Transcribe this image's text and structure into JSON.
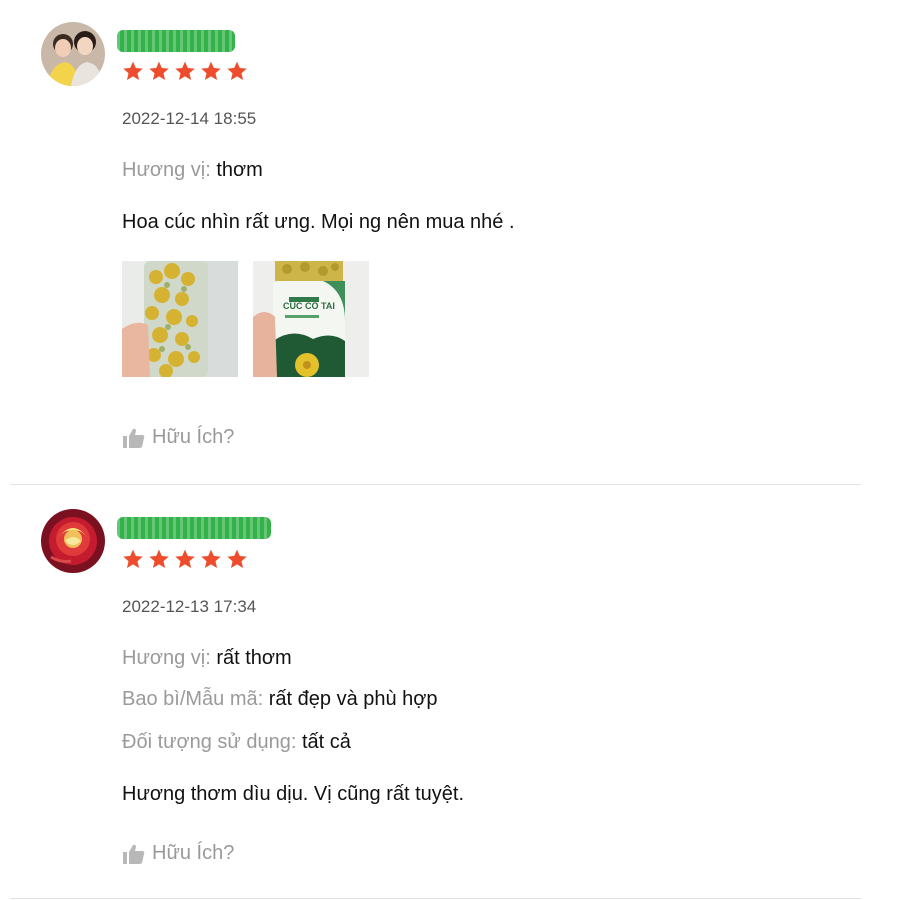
{
  "reviews": [
    {
      "username_hidden": true,
      "rating": 5,
      "date": "2022-12-14 18:55",
      "attributes": [
        {
          "key": "Hương vị:",
          "value": "thơm"
        }
      ],
      "comment": "Hoa cúc nhìn rất ưng. Mọi ng nên mua nhé .",
      "photos": [
        {
          "alt": "Jar of dried chrysanthemum flowers"
        },
        {
          "alt": "Cúc Cổ Tai product jar",
          "label": "CÚC CỔ TAI"
        }
      ],
      "helpful_label": "Hữu Ích?"
    },
    {
      "username_hidden": true,
      "rating": 5,
      "date": "2022-12-13 17:34",
      "attributes": [
        {
          "key": "Hương vị:",
          "value": "rất thơm"
        },
        {
          "key": "Bao bì/Mẫu mã:",
          "value": "rất đẹp và phù hợp"
        },
        {
          "key": "Đối tượng sử dụng:",
          "value": "tất cả"
        }
      ],
      "comment": "Hương thơm dìu dịu. Vị cũng rất tuyệt.",
      "photos": [],
      "helpful_label": "Hữu Ích?"
    }
  ],
  "colors": {
    "star": "#ee4d2d",
    "muted": "#9a9a9a",
    "divider": "#e2e2e2",
    "username_redaction": "#33b24a"
  }
}
